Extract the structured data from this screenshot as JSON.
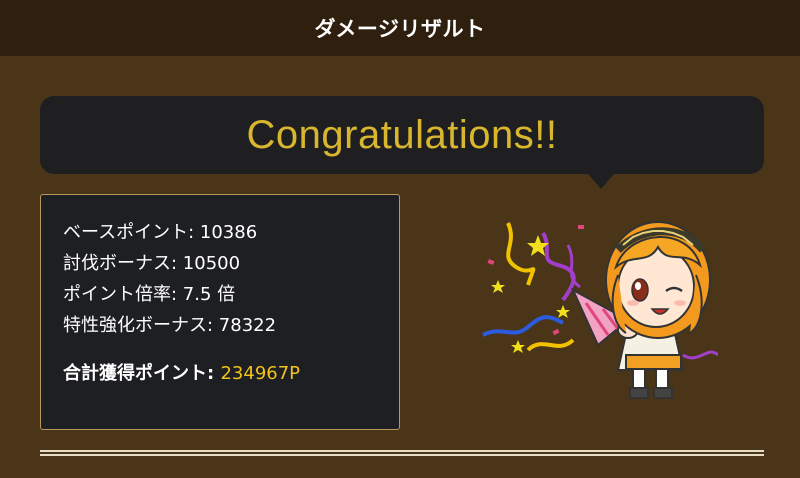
{
  "header": {
    "title": "ダメージリザルト"
  },
  "banner": {
    "text": "Congratulations!!"
  },
  "results": {
    "base": {
      "label": "ベースポイント",
      "value": "10386"
    },
    "subjugation": {
      "label": "討伐ボーナス",
      "value": "10500"
    },
    "multiplier": {
      "label": "ポイント倍率",
      "value": "7.5 倍"
    },
    "special": {
      "label": "特性強化ボーナス",
      "value": "78322"
    },
    "total": {
      "label": "合計獲得ポイント",
      "value": "234967P"
    }
  },
  "colors": {
    "accent": "#d8b62e",
    "total": "#f0c419",
    "background": "#4a3519"
  },
  "mascot": {
    "icon": "party-popper-character"
  }
}
